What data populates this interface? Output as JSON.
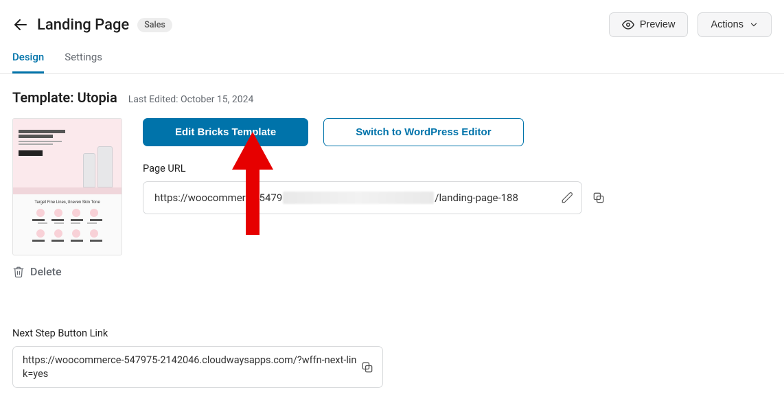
{
  "header": {
    "title": "Landing Page",
    "badge": "Sales",
    "preview": "Preview",
    "actions": "Actions"
  },
  "tabs": {
    "design": "Design",
    "settings": "Settings"
  },
  "template": {
    "title": "Template: Utopia",
    "last_edited": "Last Edited: October 15, 2024",
    "delete": "Delete",
    "edit_button": "Edit Bricks Template",
    "switch_button": "Switch to WordPress Editor"
  },
  "page_url": {
    "label": "Page URL",
    "prefix": "https://woocommerce-5479",
    "suffix": "/landing-page-188"
  },
  "next_step": {
    "label": "Next Step Button Link",
    "value": "https://woocommerce-547975-2142046.cloudwaysapps.com/?wffn-next-link=yes"
  }
}
